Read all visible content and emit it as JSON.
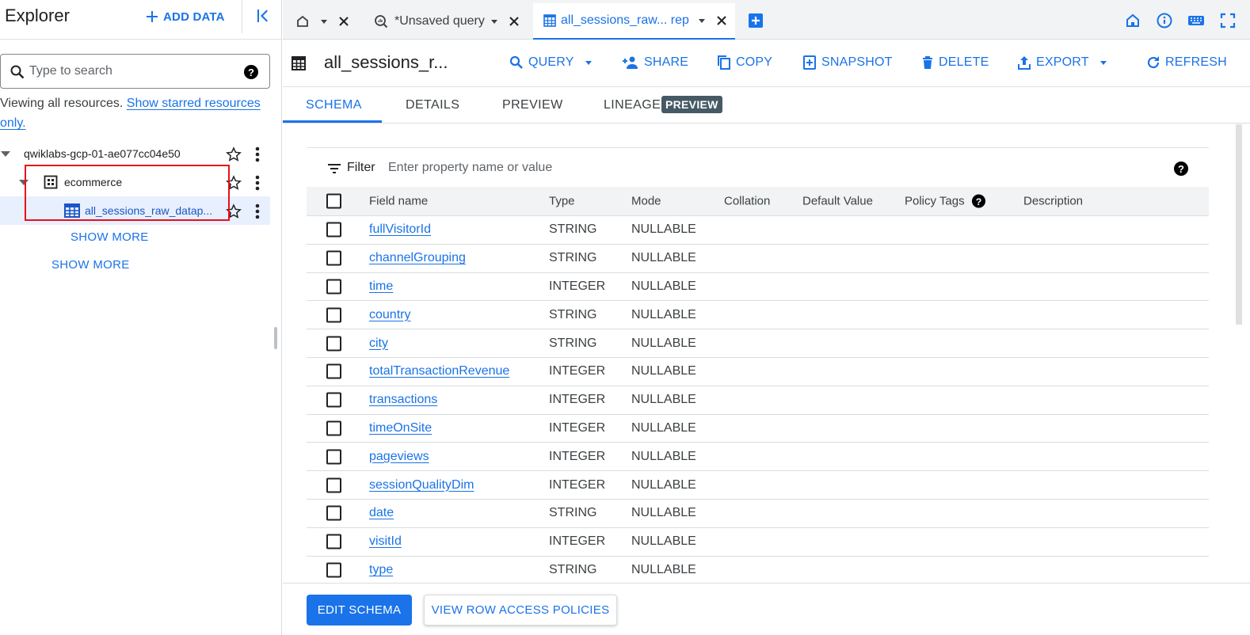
{
  "explorer": {
    "title": "Explorer",
    "add_data_label": "ADD DATA",
    "search_placeholder": "Type to search",
    "viewing_text": "Viewing all resources.",
    "starred_link": "Show starred resources only.",
    "project": "qwiklabs-gcp-01-ae077cc04e50",
    "dataset": "ecommerce",
    "table": "all_sessions_raw_datap...",
    "show_more_inner": "SHOW MORE",
    "show_more_outer": "SHOW MORE"
  },
  "tabs": {
    "query_tab": "*Unsaved query",
    "table_tab": "all_sessions_raw... rep"
  },
  "toolbar": {
    "table_name": "all_sessions_r...",
    "query": "QUERY",
    "share": "SHARE",
    "copy": "COPY",
    "snapshot": "SNAPSHOT",
    "delete": "DELETE",
    "export": "EXPORT",
    "refresh": "REFRESH"
  },
  "content_tabs": {
    "schema": "SCHEMA",
    "details": "DETAILS",
    "preview": "PREVIEW",
    "lineage": "LINEAGE",
    "lineage_badge": "PREVIEW"
  },
  "filter": {
    "label": "Filter",
    "placeholder": "Enter property name or value"
  },
  "schema": {
    "headers": {
      "field_name": "Field name",
      "type": "Type",
      "mode": "Mode",
      "collation": "Collation",
      "default_value": "Default Value",
      "policy_tags": "Policy Tags",
      "description": "Description"
    },
    "rows": [
      {
        "name": "fullVisitorId",
        "type": "STRING",
        "mode": "NULLABLE"
      },
      {
        "name": "channelGrouping",
        "type": "STRING",
        "mode": "NULLABLE"
      },
      {
        "name": "time",
        "type": "INTEGER",
        "mode": "NULLABLE"
      },
      {
        "name": "country",
        "type": "STRING",
        "mode": "NULLABLE"
      },
      {
        "name": "city",
        "type": "STRING",
        "mode": "NULLABLE"
      },
      {
        "name": "totalTransactionRevenue",
        "type": "INTEGER",
        "mode": "NULLABLE"
      },
      {
        "name": "transactions",
        "type": "INTEGER",
        "mode": "NULLABLE"
      },
      {
        "name": "timeOnSite",
        "type": "INTEGER",
        "mode": "NULLABLE"
      },
      {
        "name": "pageviews",
        "type": "INTEGER",
        "mode": "NULLABLE"
      },
      {
        "name": "sessionQualityDim",
        "type": "INTEGER",
        "mode": "NULLABLE"
      },
      {
        "name": "date",
        "type": "STRING",
        "mode": "NULLABLE"
      },
      {
        "name": "visitId",
        "type": "INTEGER",
        "mode": "NULLABLE"
      },
      {
        "name": "type",
        "type": "STRING",
        "mode": "NULLABLE"
      }
    ]
  },
  "actions": {
    "edit_schema": "EDIT SCHEMA",
    "row_access": "VIEW ROW ACCESS POLICIES"
  },
  "colors": {
    "accent": "#1a73e8",
    "highlight_box": "#e8101a",
    "selected_row": "#e8f0fe"
  },
  "icons": [
    "home-icon",
    "query-icon",
    "table-icon",
    "add-tab-icon",
    "info-icon",
    "keyboard-icon",
    "fullscreen-icon",
    "search-icon",
    "help-icon",
    "star-icon",
    "more-vert-icon",
    "dataset-icon",
    "filter-icon",
    "share-icon",
    "copy-icon",
    "snapshot-icon",
    "delete-icon",
    "export-icon",
    "refresh-icon"
  ]
}
